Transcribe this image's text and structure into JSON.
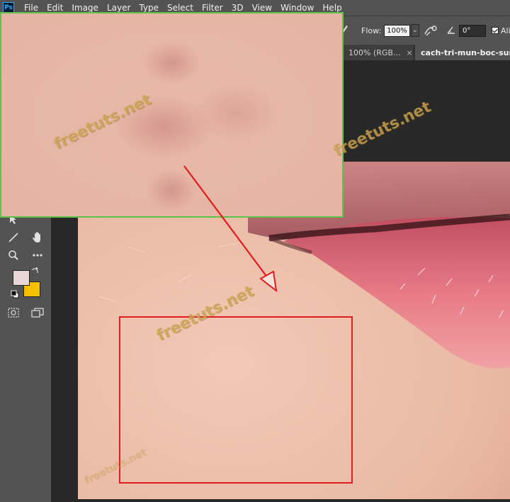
{
  "app": {
    "logo": "Ps",
    "menu": [
      "File",
      "Edit",
      "Image",
      "Layer",
      "Type",
      "Select",
      "Filter",
      "3D",
      "View",
      "Window",
      "Help"
    ]
  },
  "options": {
    "flow_label": "Flow:",
    "flow_value": "100%",
    "angle_value": "0°",
    "align_label": "Alig"
  },
  "tabs": [
    {
      "label": "100% (RGB...",
      "close": "×"
    },
    {
      "label": "cach-tri-mun-boc-sung-"
    }
  ],
  "watermarks": [
    "freetuts.net",
    "freetuts.net",
    "freetuts.net",
    "freetuts.net"
  ],
  "colors": {
    "inset_border": "#5cc24a",
    "highlight_box": "#e01d1d",
    "arrow": "#e01d1d",
    "foreground_swatch": "#e8d5d8",
    "background_swatch": "#f5c000"
  },
  "icons": [
    "brush-icon",
    "pressure-icon",
    "angle-icon",
    "move-icon",
    "line-icon",
    "hand-icon",
    "zoom-icon",
    "more-icon",
    "swap-colors-icon",
    "default-colors-icon",
    "quick-mask-icon",
    "screen-mode-icon"
  ]
}
